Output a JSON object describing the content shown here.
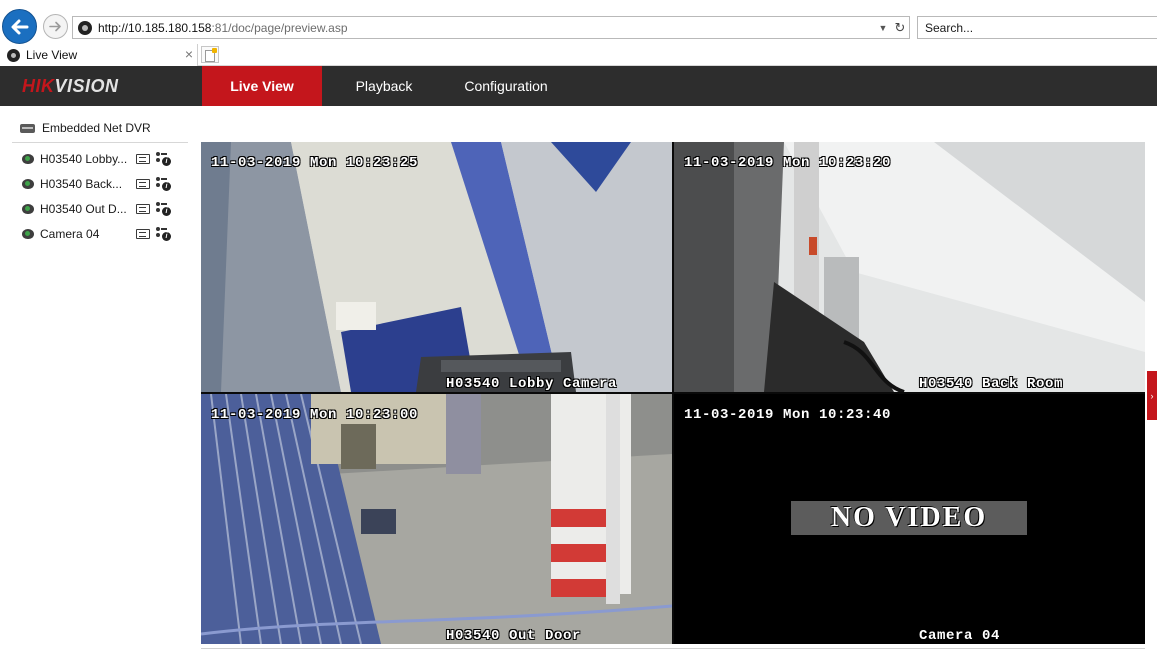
{
  "browser": {
    "url_host": "http://10.185.180.158",
    "url_rest": ":81/doc/page/preview.asp",
    "search_placeholder": "Search...",
    "tab_title": "Live View",
    "tab_close": "×",
    "back_icon": "back-arrow-icon",
    "forward_icon": "forward-arrow-icon",
    "refresh_glyph": "↻",
    "dropdown_glyph": "▼"
  },
  "header": {
    "logo_hik": "HIK",
    "logo_vision": "VISION",
    "nav": [
      {
        "label": "Live View",
        "active": true
      },
      {
        "label": "Playback",
        "active": false
      },
      {
        "label": "Configuration",
        "active": false
      }
    ],
    "accent_color": "#c4161c",
    "bar_color": "#2d2d2d"
  },
  "sidebar": {
    "device_label": "Embedded Net DVR",
    "cameras": [
      {
        "label": "H03540 Lobby..."
      },
      {
        "label": "H03540 Back..."
      },
      {
        "label": "H03540 Out D..."
      },
      {
        "label": "Camera 04"
      }
    ]
  },
  "grid": {
    "tiles": [
      {
        "timestamp": "11-03-2019 Mon 10:23:25",
        "camera_name": "H03540 Lobby Camera",
        "selected": true
      },
      {
        "timestamp": "11-03-2019 Mon 10:23:20",
        "camera_name": "H03540 Back Room",
        "selected": false
      },
      {
        "timestamp": "11-03-2019 Mon 10:23:00",
        "camera_name": "H03540 Out Door",
        "selected": false
      },
      {
        "timestamp": "11-03-2019 Mon 10:23:40",
        "camera_name": "Camera 04",
        "no_video_text": "NO VIDEO",
        "selected": false
      }
    ]
  },
  "side_handle_glyph": "›"
}
